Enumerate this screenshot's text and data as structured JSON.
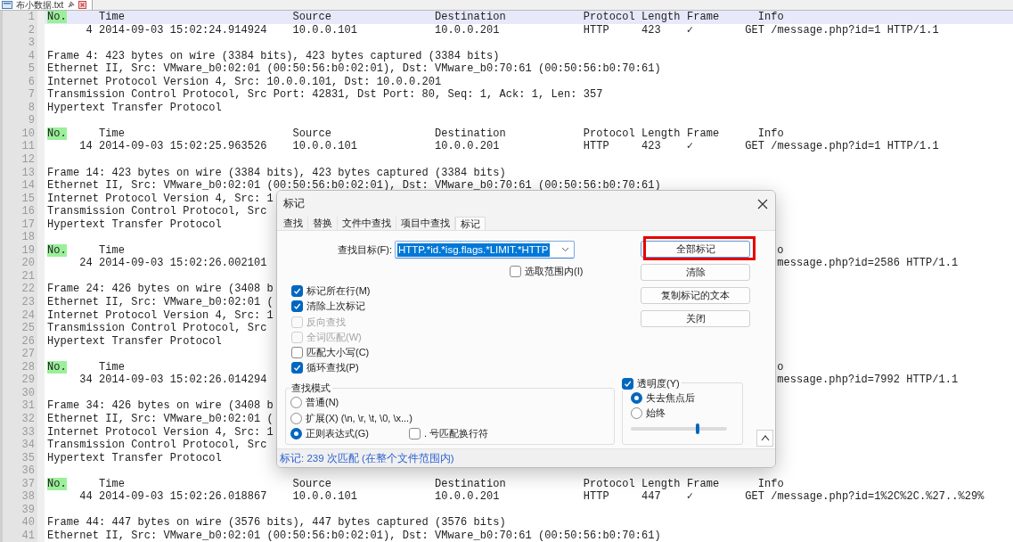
{
  "file_tab": {
    "label": "布小数据.txt"
  },
  "editor": {
    "lines": [
      {
        "number": "1",
        "kind": "header",
        "match": "No.",
        "text": "     Time                          Source                Destination            Protocol Length Frame      Info",
        "current": true
      },
      {
        "number": "2",
        "kind": "code",
        "text": "      4 2014-09-03 15:02:24.914924    10.0.0.101            10.0.0.201             HTTP     423    ✓        GET /message.php?id=1 HTTP/1.1",
        "current": false
      },
      {
        "number": "3",
        "kind": "blank",
        "current": false
      },
      {
        "number": "4",
        "kind": "code",
        "text": "Frame 4: 423 bytes on wire (3384 bits), 423 bytes captured (3384 bits)",
        "current": false
      },
      {
        "number": "5",
        "kind": "code",
        "text": "Ethernet II, Src: VMware_b0:02:01 (00:50:56:b0:02:01), Dst: VMware_b0:70:61 (00:50:56:b0:70:61)",
        "current": false
      },
      {
        "number": "6",
        "kind": "code",
        "text": "Internet Protocol Version 4, Src: 10.0.0.101, Dst: 10.0.0.201",
        "current": false
      },
      {
        "number": "7",
        "kind": "code",
        "text": "Transmission Control Protocol, Src Port: 42831, Dst Port: 80, Seq: 1, Ack: 1, Len: 357",
        "current": false
      },
      {
        "number": "8",
        "kind": "code",
        "text": "Hypertext Transfer Protocol",
        "current": false
      },
      {
        "number": "9",
        "kind": "blank",
        "current": false
      },
      {
        "number": "10",
        "kind": "header",
        "match": "No.",
        "text": "     Time                          Source                Destination            Protocol Length Frame      Info",
        "current": false
      },
      {
        "number": "11",
        "kind": "code",
        "text": "     14 2014-09-03 15:02:25.963526    10.0.0.101            10.0.0.201             HTTP     423    ✓        GET /message.php?id=1 HTTP/1.1",
        "current": false
      },
      {
        "number": "12",
        "kind": "blank",
        "current": false
      },
      {
        "number": "13",
        "kind": "code",
        "text": "Frame 14: 423 bytes on wire (3384 bits), 423 bytes captured (3384 bits)",
        "current": false
      },
      {
        "number": "14",
        "kind": "code",
        "text": "Ethernet II, Src: VMware_b0:02:01 (00:50:56:b0:02:01), Dst: VMware_b0:70:61 (00:50:56:b0:70:61)",
        "current": false
      },
      {
        "number": "15",
        "kind": "code",
        "text": "Internet Protocol Version 4, Src: 1",
        "current": false
      },
      {
        "number": "16",
        "kind": "code",
        "text": "Transmission Control Protocol, Src",
        "current": false
      },
      {
        "number": "17",
        "kind": "code",
        "text": "Hypertext Transfer Protocol",
        "current": false
      },
      {
        "number": "18",
        "kind": "blank",
        "current": false
      },
      {
        "number": "19",
        "kind": "header",
        "match": "No.",
        "text": "     Time",
        "tail": "o",
        "current": false
      },
      {
        "number": "20",
        "kind": "code",
        "text": "     24 2014-09-03 15:02:26.002101",
        "tail": "message.php?id=2586 HTTP/1.1",
        "current": false
      },
      {
        "number": "21",
        "kind": "blank",
        "current": false
      },
      {
        "number": "22",
        "kind": "code",
        "text": "Frame 24: 426 bytes on wire (3408 b",
        "current": false
      },
      {
        "number": "23",
        "kind": "code",
        "text": "Ethernet II, Src: VMware_b0:02:01 (",
        "current": false
      },
      {
        "number": "24",
        "kind": "code",
        "text": "Internet Protocol Version 4, Src: 1",
        "current": false
      },
      {
        "number": "25",
        "kind": "code",
        "text": "Transmission Control Protocol, Src",
        "current": false
      },
      {
        "number": "26",
        "kind": "code",
        "text": "Hypertext Transfer Protocol",
        "current": false
      },
      {
        "number": "27",
        "kind": "blank",
        "current": false
      },
      {
        "number": "28",
        "kind": "header",
        "match": "No.",
        "text": "     Time",
        "tail": "o",
        "current": false
      },
      {
        "number": "29",
        "kind": "code",
        "text": "     34 2014-09-03 15:02:26.014294",
        "tail": "message.php?id=7992 HTTP/1.1",
        "current": false
      },
      {
        "number": "30",
        "kind": "blank",
        "current": false
      },
      {
        "number": "31",
        "kind": "code",
        "text": "Frame 34: 426 bytes on wire (3408 b",
        "current": false
      },
      {
        "number": "32",
        "kind": "code",
        "text": "Ethernet II, Src: VMware_b0:02:01 (",
        "current": false
      },
      {
        "number": "33",
        "kind": "code",
        "text": "Internet Protocol Version 4, Src: 1",
        "current": false
      },
      {
        "number": "34",
        "kind": "code",
        "text": "Transmission Control Protocol, Src",
        "current": false
      },
      {
        "number": "35",
        "kind": "code",
        "text": "Hypertext Transfer Protocol",
        "current": false
      },
      {
        "number": "36",
        "kind": "blank",
        "current": false
      },
      {
        "number": "37",
        "kind": "header",
        "match": "No.",
        "text": "     Time                          Source                Destination            Protocol Length Frame      Info",
        "current": false
      },
      {
        "number": "38",
        "kind": "code",
        "text": "     44 2014-09-03 15:02:26.018867    10.0.0.101            10.0.0.201             HTTP     447    ✓        GET /message.php?id=1%2C%2C.%27..%29%",
        "current": false
      },
      {
        "number": "39",
        "kind": "blank",
        "current": false
      },
      {
        "number": "40",
        "kind": "code",
        "text": "Frame 44: 447 bytes on wire (3576 bits), 447 bytes captured (3576 bits)",
        "current": false
      },
      {
        "number": "41",
        "kind": "code",
        "text": "Ethernet II, Src: VMware_b0:02:01 (00:50:56:b0:02:01), Dst: VMware_b0:70:61 (00:50:56:b0:70:61)",
        "current": false
      }
    ]
  },
  "dialog": {
    "title": "标记",
    "tabs": [
      {
        "label": "查找",
        "selected": false
      },
      {
        "label": "替换",
        "selected": false
      },
      {
        "label": "文件中查找",
        "selected": false
      },
      {
        "label": "项目中查找",
        "selected": false
      },
      {
        "label": "标记",
        "selected": true
      }
    ],
    "find_label": "查找目标(F):",
    "find_value": "HTTP.*id.*isg.flags.*LIMIT.*HTTP",
    "find_value_selected": true,
    "in_selection": {
      "label": "选取范围内(I)",
      "checked": false
    },
    "options": [
      {
        "label": "标记所在行(M)",
        "checked": true,
        "disabled": false
      },
      {
        "label": "清除上次标记",
        "checked": true,
        "disabled": false
      },
      {
        "label": "反向查找",
        "checked": false,
        "disabled": true
      },
      {
        "label": "全词匹配(W)",
        "checked": false,
        "disabled": true
      },
      {
        "label": "匹配大小写(C)",
        "checked": false,
        "disabled": false
      },
      {
        "label": "循环查找(P)",
        "checked": true,
        "disabled": false
      }
    ],
    "buttons": [
      {
        "label": "全部标记",
        "highlighted": true
      },
      {
        "label": "清除",
        "highlighted": false
      },
      {
        "label": "复制标记的文本",
        "highlighted": false
      },
      {
        "label": "关闭",
        "highlighted": false
      }
    ],
    "search_mode": {
      "title": "查找模式",
      "options": [
        {
          "kind": "radio",
          "label": "普通(N)",
          "selected": false
        },
        {
          "kind": "radio",
          "label": "扩展(X) (\\n, \\r, \\t, \\0, \\x...)",
          "selected": false
        },
        {
          "kind": "radio",
          "label": "正则表达式(G)",
          "selected": true
        },
        {
          "kind": "checkbox",
          "label": ". 号匹配换行符",
          "checked": false
        }
      ]
    },
    "transparency": {
      "label": "透明度(Y)",
      "checked": true,
      "options": [
        {
          "label": "失去焦点后",
          "selected": true
        },
        {
          "label": "始终",
          "selected": false
        }
      ],
      "level": 0.69
    },
    "status": "标记: 239 次匹配 (在整个文件范围内)"
  }
}
